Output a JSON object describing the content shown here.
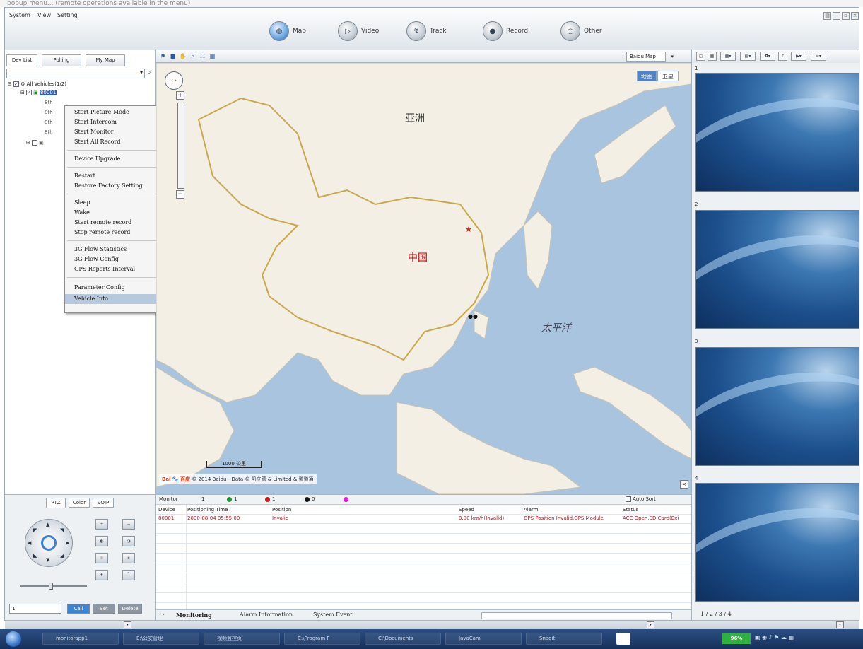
{
  "top_strip_text": "popup menu... (remote operations available in the menu)",
  "menubar": {
    "items": [
      "System",
      "View",
      "Setting"
    ],
    "nav": [
      {
        "label": "Map",
        "active": true,
        "icon": "globe-icon"
      },
      {
        "label": "Video",
        "active": false,
        "icon": "video-icon"
      },
      {
        "label": "Track",
        "active": false,
        "icon": "track-icon"
      },
      {
        "label": "Record",
        "active": false,
        "icon": "record-icon"
      },
      {
        "label": "Other",
        "active": false,
        "icon": "other-icon"
      }
    ]
  },
  "left": {
    "tabs": [
      "Dev List",
      "Polling",
      "My Map"
    ],
    "tree_root": "All Vehicles(1/2)",
    "tree_device": "80001",
    "tree_children": [
      "8th",
      "8th",
      "8th",
      "8th"
    ]
  },
  "context_menu": {
    "items": [
      {
        "label": "Start Picture Mode"
      },
      {
        "label": "Start Intercom"
      },
      {
        "label": "Start Monitor"
      },
      {
        "label": "Start All Record"
      },
      {
        "label": "Device Upgrade"
      },
      {
        "label": "Restart"
      },
      {
        "label": "Restore Factory Setting"
      },
      {
        "label": "Sleep"
      },
      {
        "label": "Wake"
      },
      {
        "label": "Start remote record"
      },
      {
        "label": "Stop remote record"
      },
      {
        "label": "3G Flow Statistics"
      },
      {
        "label": "3G Flow Config"
      },
      {
        "label": "GPS Reports Interval"
      },
      {
        "label": "Parameter Config"
      },
      {
        "label": "Vehicle Info",
        "selected": true
      }
    ]
  },
  "ptz": {
    "tabs": [
      "PTZ",
      "Color",
      "VOIP"
    ],
    "preset_value": "1",
    "buttons": [
      "Call",
      "Set",
      "Delete"
    ]
  },
  "map": {
    "map_type": "Baidu Map",
    "view_buttons": [
      "地图",
      "卫星"
    ],
    "labels": {
      "asia": "亚洲",
      "china": "中国",
      "pacific": "太平洋"
    },
    "scale": "1000 公里",
    "copyright": "© 2014 Baidu - Data © 凯立德 & Limited & 道道通"
  },
  "monitor": {
    "title": "Monitor",
    "counts": [
      {
        "value": "1",
        "color": "#1a9a2a"
      },
      {
        "value": "1",
        "color": "#d11a1a"
      },
      {
        "value": "0",
        "color": "#111111"
      },
      {
        "value": "",
        "color": "#e21bd6"
      }
    ],
    "total": "1",
    "auto_sort": "Auto Sort",
    "columns": [
      "Device",
      "Positioning Time",
      "Position",
      "Speed",
      "Alarm",
      "Status"
    ],
    "rows": [
      [
        "80001",
        "2000-08-04 05:55:00",
        "Invalid",
        "0.00 km/h(Invalid)",
        "GPS Position Invalid,GPS Module",
        "ACC Open,SD Card(Exi"
      ]
    ],
    "tabs": [
      "Monitoring",
      "Alarm Information",
      "System Event"
    ]
  },
  "right": {
    "panels": [
      "1",
      "2",
      "3",
      "4"
    ],
    "tabs": "1 / 2 / 3 / 4"
  },
  "taskbar": {
    "tasks": [
      "monitorapp1",
      "E:\\公安管理",
      "视频监控页",
      "C:\\Program F",
      "C:\\Documents",
      "JavaCam",
      "Snagit"
    ],
    "tray_status": "96%"
  }
}
